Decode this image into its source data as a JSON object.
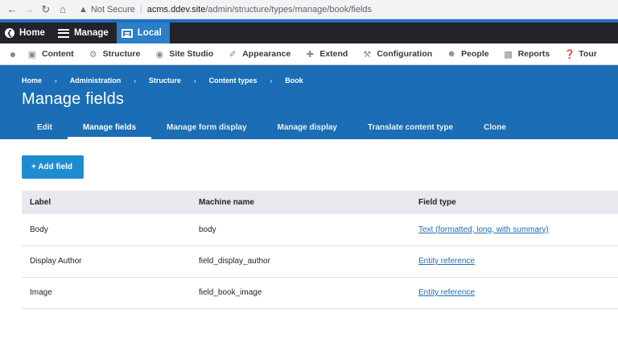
{
  "browser": {
    "security_label": "Not Secure",
    "url_host": "acms.ddev.site",
    "url_path": "/admin/structure/types/manage/book/fields"
  },
  "toolbar": {
    "home_label": "Home",
    "manage_label": "Manage",
    "local_label": "Local"
  },
  "admin_menu": {
    "items": [
      {
        "label": "Content",
        "icon": "document-icon"
      },
      {
        "label": "Structure",
        "icon": "structure-icon"
      },
      {
        "label": "Site Studio",
        "icon": "studio-icon"
      },
      {
        "label": "Appearance",
        "icon": "brush-icon"
      },
      {
        "label": "Extend",
        "icon": "puzzle-icon"
      },
      {
        "label": "Configuration",
        "icon": "wrench-icon"
      },
      {
        "label": "People",
        "icon": "people-icon"
      },
      {
        "label": "Reports",
        "icon": "bar-chart-icon"
      },
      {
        "label": "Tour",
        "icon": "help-icon"
      }
    ]
  },
  "breadcrumb": [
    "Home",
    "Administration",
    "Structure",
    "Content types",
    "Book"
  ],
  "page_title": "Manage fields",
  "tabs": [
    {
      "label": "Edit"
    },
    {
      "label": "Manage fields",
      "active": true
    },
    {
      "label": "Manage form display"
    },
    {
      "label": "Manage display"
    },
    {
      "label": "Translate content type"
    },
    {
      "label": "Clone"
    }
  ],
  "add_field_label": "+ Add field",
  "table": {
    "headers": [
      "Label",
      "Machine name",
      "Field type"
    ],
    "rows": [
      {
        "label": "Body",
        "machine_name": "body",
        "field_type": "Text (formatted, long, with summary)"
      },
      {
        "label": "Display Author",
        "machine_name": "field_display_author",
        "field_type": "Entity reference"
      },
      {
        "label": "Image",
        "machine_name": "field_book_image",
        "field_type": "Entity reference"
      }
    ]
  },
  "colors": {
    "header_blue": "#1b6db5",
    "toolbar_dark": "#232429",
    "button_blue": "#1f8cd0",
    "link_blue": "#1f6db9"
  }
}
